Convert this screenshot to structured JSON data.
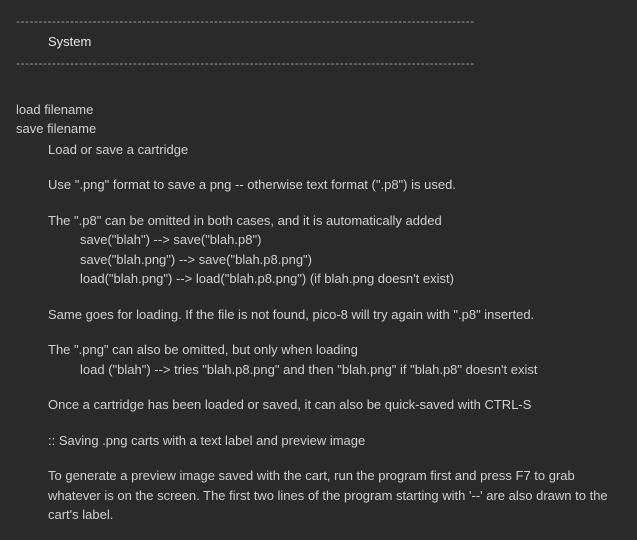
{
  "divider": "------------------------------------------------------------------------------------------------------",
  "sectionTitle": "System",
  "cmd1": "load filename",
  "cmd2": "save filename",
  "desc1": "Load or save a cartridge",
  "para1": "Use \".png\" format to save a png -- otherwise text format (\".p8\") is used.",
  "para2": "The \".p8\" can be omitted in both cases, and it is automatically added",
  "ex1": "save(\"blah\") --> save(\"blah.p8\")",
  "ex2": "save(\"blah.png\") --> save(\"blah.p8.png\")",
  "ex3": "load(\"blah.png\") --> load(\"blah.p8.png\") (if blah.png doesn't exist)",
  "para3": "Same goes for loading. If the file is not found, pico-8 will try again with \".p8\" inserted.",
  "para4": "The \".png\" can also be omitted, but only when loading",
  "ex4": "load (\"blah\") --> tries \"blah.p8.png\" and then \"blah.png\" if \"blah.p8\" doesn't exist",
  "para5": "Once a cartridge has been loaded or saved, it can also be quick-saved with CTRL-S",
  "subheading": ":: Saving .png carts with a text label and preview image",
  "para6": "To generate a preview image saved with the cart, run the program first and press F7 to grab whatever is on the screen. The first two lines of the program starting with '--' are also drawn to the cart's label."
}
